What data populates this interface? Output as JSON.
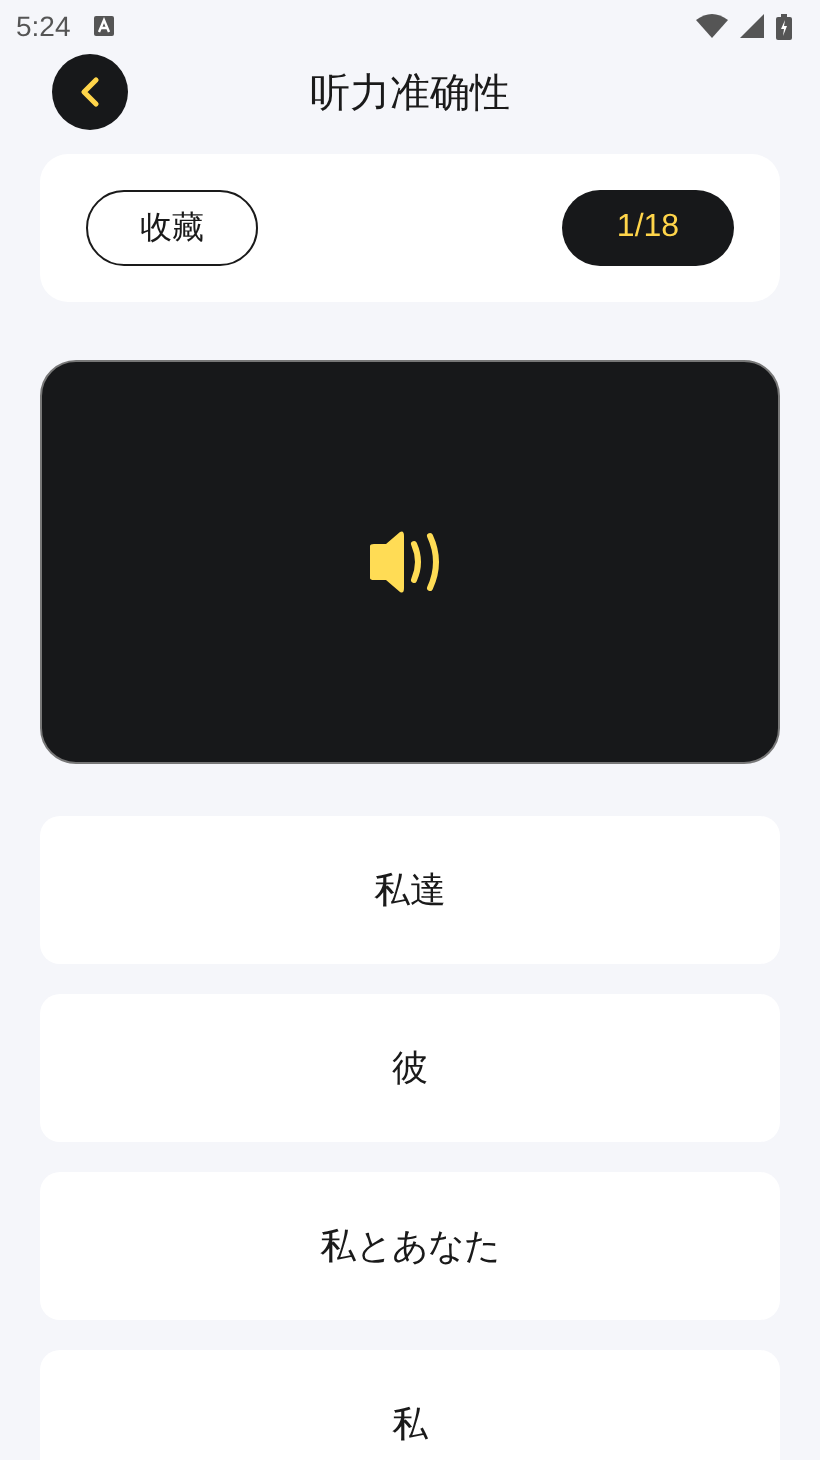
{
  "status_bar": {
    "time": "5:24"
  },
  "header": {
    "title": "听力准确性"
  },
  "toolbar": {
    "favorite_label": "收藏",
    "counter": "1/18"
  },
  "options": [
    {
      "label": "私達"
    },
    {
      "label": "彼"
    },
    {
      "label": "私とあなた"
    },
    {
      "label": "私"
    }
  ]
}
